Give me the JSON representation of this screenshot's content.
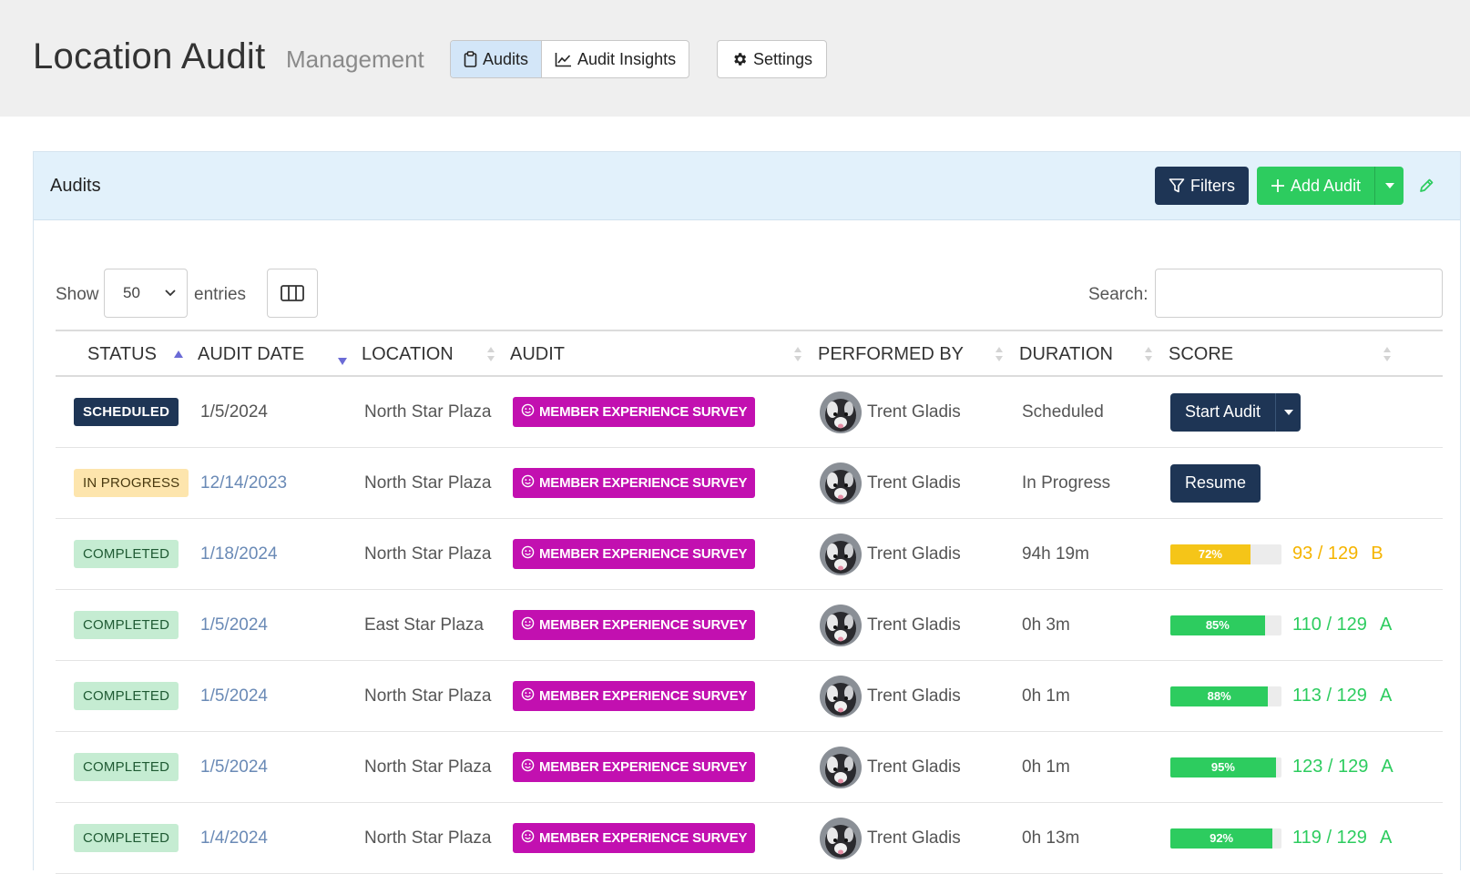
{
  "header": {
    "title": "Location Audit",
    "subtitle": "Management",
    "nav": [
      {
        "label": "Audits",
        "icon": "clipboard-icon",
        "active": true
      },
      {
        "label": "Audit Insights",
        "icon": "line-chart-icon",
        "active": false
      }
    ],
    "settings_label": "Settings"
  },
  "panel": {
    "title": "Audits",
    "filters_label": "Filters",
    "add_label": "Add Audit"
  },
  "controls": {
    "show_label": "Show",
    "page_size": "50",
    "entries_label": "entries",
    "search_label": "Search:",
    "search_value": ""
  },
  "columns": [
    "STATUS",
    "AUDIT DATE",
    "LOCATION",
    "AUDIT",
    "PERFORMED BY",
    "DURATION",
    "SCORE"
  ],
  "rows": [
    {
      "status": "SCHEDULED",
      "status_type": "scheduled",
      "date": "1/5/2024",
      "date_link": false,
      "location": "North Star Plaza",
      "audit": "MEMBER EXPERIENCE SURVEY",
      "performer": "Trent Gladis",
      "duration": "Scheduled",
      "action": "Start Audit",
      "action_caret": true
    },
    {
      "status": "IN PROGRESS",
      "status_type": "progress",
      "date": "12/14/2023",
      "date_link": true,
      "location": "North Star Plaza",
      "audit": "MEMBER EXPERIENCE SURVEY",
      "performer": "Trent Gladis",
      "duration": "In Progress",
      "action": "Resume",
      "action_caret": false
    },
    {
      "status": "COMPLETED",
      "status_type": "completed",
      "date": "1/18/2024",
      "date_link": true,
      "location": "North Star Plaza",
      "audit": "MEMBER EXPERIENCE SURVEY",
      "performer": "Trent Gladis",
      "duration": "94h 19m",
      "percent": 72,
      "percent_label": "72%",
      "score": "93 / 129",
      "grade": "B",
      "score_color": "#f5b400",
      "bar_color": "#f5c518"
    },
    {
      "status": "COMPLETED",
      "status_type": "completed",
      "date": "1/5/2024",
      "date_link": true,
      "location": "East Star Plaza",
      "audit": "MEMBER EXPERIENCE SURVEY",
      "performer": "Trent Gladis",
      "duration": "0h 3m",
      "percent": 85,
      "percent_label": "85%",
      "score": "110 / 129",
      "grade": "A",
      "score_color": "#2dcc5f",
      "bar_color": "#2dcc5f"
    },
    {
      "status": "COMPLETED",
      "status_type": "completed",
      "date": "1/5/2024",
      "date_link": true,
      "location": "North Star Plaza",
      "audit": "MEMBER EXPERIENCE SURVEY",
      "performer": "Trent Gladis",
      "duration": "0h 1m",
      "percent": 88,
      "percent_label": "88%",
      "score": "113 / 129",
      "grade": "A",
      "score_color": "#2dcc5f",
      "bar_color": "#2dcc5f"
    },
    {
      "status": "COMPLETED",
      "status_type": "completed",
      "date": "1/5/2024",
      "date_link": true,
      "location": "North Star Plaza",
      "audit": "MEMBER EXPERIENCE SURVEY",
      "performer": "Trent Gladis",
      "duration": "0h 1m",
      "percent": 95,
      "percent_label": "95%",
      "score": "123 / 129",
      "grade": "A",
      "score_color": "#2dcc5f",
      "bar_color": "#2dcc5f"
    },
    {
      "status": "COMPLETED",
      "status_type": "completed",
      "date": "1/4/2024",
      "date_link": true,
      "location": "North Star Plaza",
      "audit": "MEMBER EXPERIENCE SURVEY",
      "performer": "Trent Gladis",
      "duration": "0h 13m",
      "percent": 92,
      "percent_label": "92%",
      "score": "119 / 129",
      "grade": "A",
      "score_color": "#2dcc5f",
      "bar_color": "#2dcc5f"
    }
  ],
  "colors": {
    "navy": "#1e3555",
    "green": "#2dcc5f",
    "magenta": "#c210b0",
    "panel_head": "#e2f1fb"
  }
}
